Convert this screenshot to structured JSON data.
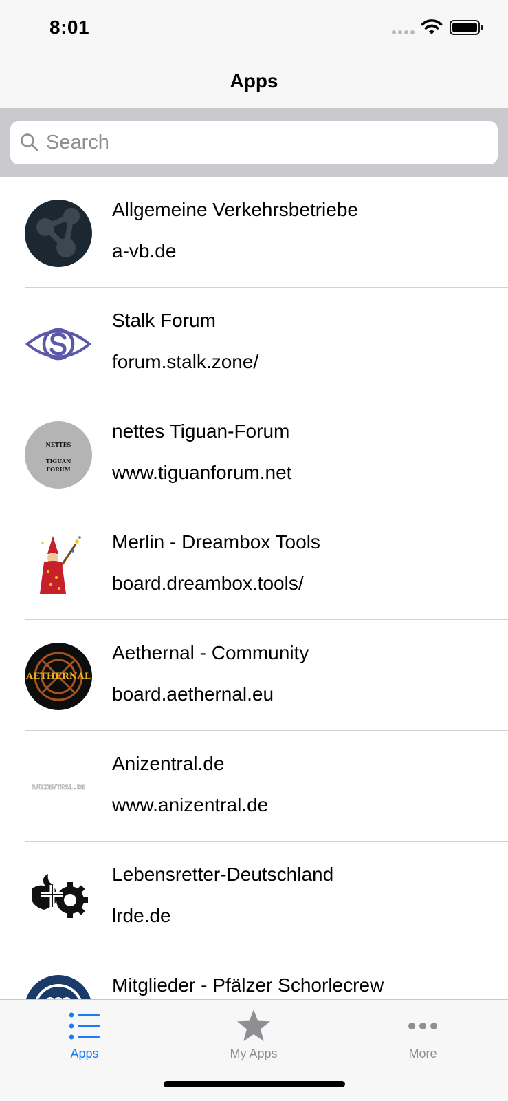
{
  "status_bar": {
    "time": "8:01"
  },
  "nav": {
    "title": "Apps"
  },
  "search": {
    "placeholder": "Search",
    "value": ""
  },
  "list": {
    "items": [
      {
        "title": "Allgemeine Verkehrsbetriebe",
        "subtitle": "a-vb.de",
        "icon": "share-network-icon"
      },
      {
        "title": "Stalk Forum",
        "subtitle": "forum.stalk.zone/",
        "icon": "eye-s-logo-icon"
      },
      {
        "title": "nettes Tiguan-Forum",
        "subtitle": "www.tiguanforum.net",
        "icon": "tiguan-forum-logo-icon",
        "logo_text": [
          "NETTES",
          "TIGUAN",
          "FORUM"
        ]
      },
      {
        "title": "Merlin - Dreambox Tools",
        "subtitle": "board.dreambox.tools/",
        "icon": "wizard-icon"
      },
      {
        "title": "Aethernal - Community",
        "subtitle": "board.aethernal.eu",
        "icon": "aethernal-logo-icon",
        "logo_text": "AETHERNAL"
      },
      {
        "title": "Anizentral.de",
        "subtitle": "www.anizentral.de",
        "icon": "anizentral-logo-icon",
        "logo_text": "ANIZENTRAL.DE"
      },
      {
        "title": "Lebensretter-Deutschland",
        "subtitle": "lrde.de",
        "icon": "lifesaver-logo-icon"
      },
      {
        "title": "Mitglieder - Pfälzer Schorlecrew",
        "subtitle": "",
        "icon": "schorlecrew-logo-icon"
      }
    ]
  },
  "tab_bar": {
    "tabs": [
      {
        "label": "Apps",
        "icon": "list-icon",
        "active": true
      },
      {
        "label": "My Apps",
        "icon": "star-icon",
        "active": false
      },
      {
        "label": "More",
        "icon": "more-icon",
        "active": false
      }
    ],
    "active_color": "#1a7cf5",
    "inactive_color": "#8e8e93"
  }
}
